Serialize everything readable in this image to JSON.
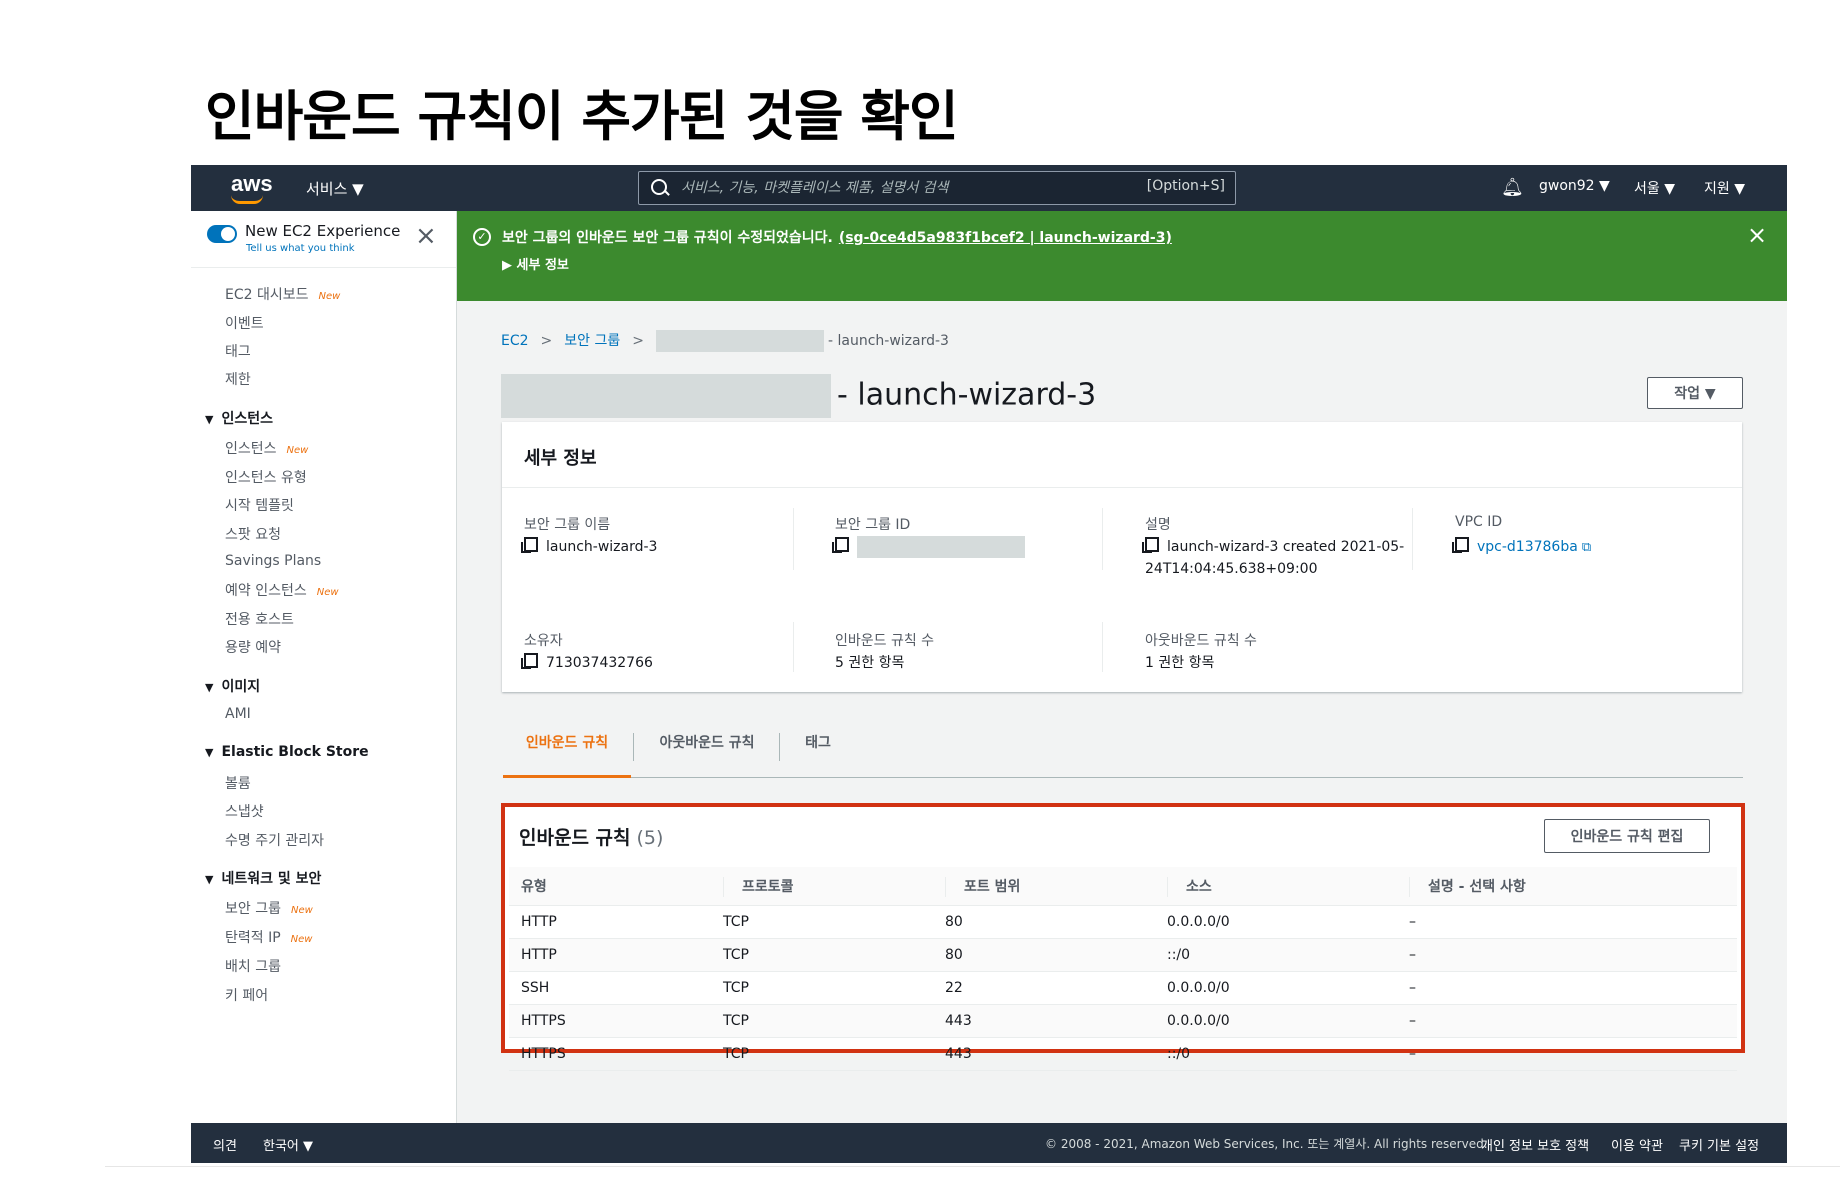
{
  "slide": {
    "title": "인바운드 규칙이 추가된 것을 확인"
  },
  "topnav": {
    "logo": "aws",
    "services": "서비스 ▼",
    "search_placeholder": "서비스, 기능, 마켓플레이스 제품, 설명서 검색",
    "search_shortcut": "[Option+S]",
    "user": "gwon92 ▼",
    "region": "서울 ▼",
    "support": "지원 ▼"
  },
  "sidebar": {
    "new_experience": "New EC2 Experience",
    "tell_us": "Tell us what you think",
    "new_badge": "New",
    "items": [
      {
        "label": "EC2 대시보드",
        "new": true
      },
      {
        "label": "이벤트"
      },
      {
        "label": "태그"
      },
      {
        "label": "제한"
      }
    ],
    "sections": [
      {
        "title": "인스턴스",
        "items": [
          "인스턴스",
          "인스턴스 유형",
          "시작 템플릿",
          "스팟 요청",
          "Savings Plans",
          "예약 인스턴스",
          "전용 호스트",
          "용량 예약"
        ]
      },
      {
        "title": "이미지",
        "items": [
          "AMI"
        ]
      },
      {
        "title": "Elastic Block Store",
        "items": [
          "볼륨",
          "스냅샷",
          "수명 주기 관리자"
        ]
      },
      {
        "title": "네트워크 및 보안",
        "items": [
          "보안 그룹",
          "탄력적 IP",
          "배치 그룹",
          "키 페어"
        ]
      }
    ]
  },
  "flash": {
    "message": "보안 그룹의 인바운드 보안 그룹 규칙이 수정되었습니다.",
    "link": "(sg-0ce4d5a983f1bcef2 | launch-wizard-3)",
    "details": "▶  세부 정보"
  },
  "breadcrumb": {
    "ec2": "EC2",
    "sg": "보안 그룹",
    "current": "- launch-wizard-3"
  },
  "page": {
    "title": "- launch-wizard-3",
    "actions": "작업  ▼"
  },
  "details": {
    "heading": "세부 정보",
    "sg_name_label": "보안 그룹 이름",
    "sg_name": "launch-wizard-3",
    "sg_id_label": "보안 그룹 ID",
    "desc_label": "설명",
    "desc_line1": "launch-wizard-3 created 2021-05-",
    "desc_line2": "24T14:04:45.638+09:00",
    "vpc_label": "VPC ID",
    "vpc": "vpc-d13786ba",
    "owner_label": "소유자",
    "owner": "713037432766",
    "inbound_count_label": "인바운드 규칙 수",
    "inbound_count": "5 권한 항목",
    "outbound_count_label": "아웃바운드 규칙 수",
    "outbound_count": "1 권한 항목"
  },
  "tabs": [
    "인바운드 규칙",
    "아웃바운드 규칙",
    "태그"
  ],
  "rules": {
    "title": "인바운드 규칙",
    "count": "(5)",
    "edit": "인바운드 규칙 편집",
    "columns": [
      "유형",
      "프로토콜",
      "포트 범위",
      "소스",
      "설명 - 선택 사항"
    ],
    "rows": [
      [
        "HTTP",
        "TCP",
        "80",
        "0.0.0.0/0",
        "–"
      ],
      [
        "HTTP",
        "TCP",
        "80",
        "::/0",
        "–"
      ],
      [
        "SSH",
        "TCP",
        "22",
        "0.0.0.0/0",
        "–"
      ],
      [
        "HTTPS",
        "TCP",
        "443",
        "0.0.0.0/0",
        "–"
      ],
      [
        "HTTPS",
        "TCP",
        "443",
        "::/0",
        "–"
      ]
    ]
  },
  "footer": {
    "feedback": "의견",
    "language": "한국어  ▼",
    "copyright": "© 2008 - 2021, Amazon Web Services, Inc. 또는 계열사. All rights reserved.",
    "privacy": "개인 정보 보호 정책",
    "terms": "이용 약관",
    "cookies": "쿠키 기본 설정"
  }
}
